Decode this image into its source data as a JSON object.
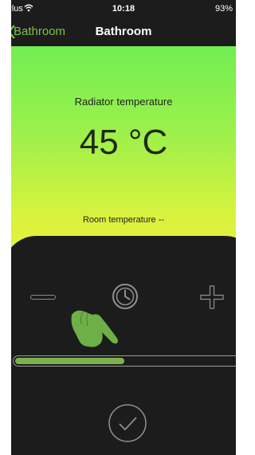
{
  "status_bar": {
    "carrier": "l Plus",
    "time": "10:18",
    "battery": "93%",
    "wifi_icon": "wifi-icon"
  },
  "nav": {
    "back_label": "Bathroom",
    "title": "Bathroom",
    "back_icon": "chevron-left-icon"
  },
  "panel": {
    "radiator_label": "Radiator temperature",
    "radiator_value": "45 °C",
    "room_label": "Room temperature --"
  },
  "controls": {
    "minus_icon": "minus-icon",
    "clock_icon": "clock-icon",
    "plus_icon": "plus-icon",
    "hand_icon": "pointing-hand-icon",
    "confirm_icon": "checkmark-circle-icon",
    "progress": 0.48
  },
  "colors": {
    "accent": "#7cc24a",
    "gradient_top": "#71ee52",
    "gradient_bottom": "#e9f13a",
    "background": "#1c1c1c",
    "progress_fill": "#7bb24c"
  }
}
